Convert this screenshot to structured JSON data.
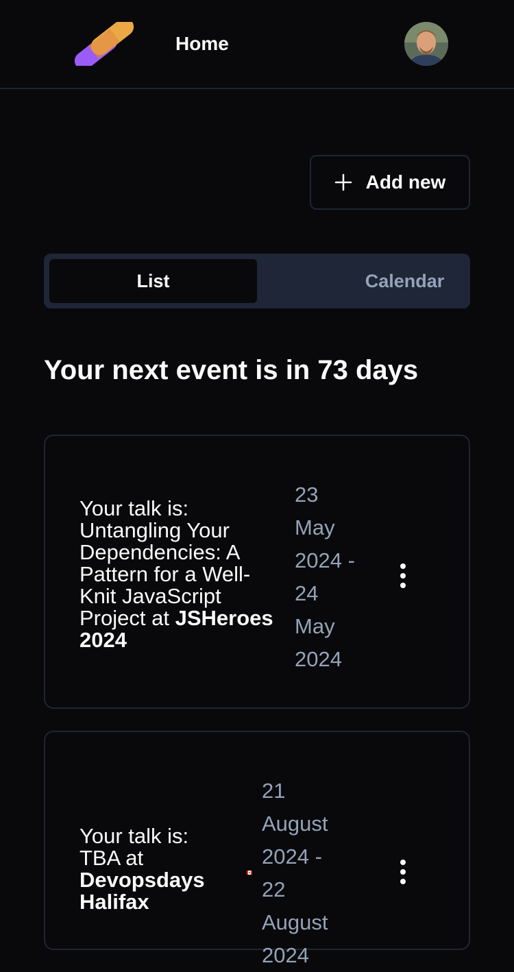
{
  "header": {
    "nav_home": "Home",
    "avatar_alt": "user avatar"
  },
  "toolbar": {
    "add_new_label": "Add new",
    "add_icon": "plus-icon"
  },
  "view_tabs": [
    {
      "label": "List",
      "active": true
    },
    {
      "label": "Calendar",
      "active": false
    }
  ],
  "next_event_text": "Your next event is in 73 days",
  "events": [
    {
      "talk_prefix": "Your talk is:",
      "talk_title": "Untangling Your Dependencies: A Pattern for a Well-Knit JavaScript Project",
      "at_word": "at",
      "event_name": "JSHeroes 2024",
      "date_range": "23 May 2024 - 24 May 2024",
      "menu_icon": "kebab-menu-icon"
    },
    {
      "talk_prefix": "Your talk is:",
      "talk_title": "TBA",
      "at_word": "at",
      "event_name": "Devopsdays Halifax",
      "date_range": "21 August 2024 - 22 August 2024",
      "flag_icon": "canada-flag-icon",
      "menu_icon": "kebab-menu-icon"
    }
  ],
  "colors": {
    "background": "#09090b",
    "border": "#1e2534",
    "tab_track": "#1e2637",
    "muted_text": "#94a3b8",
    "logo_purple": "#8b3cf7",
    "logo_orange": "#f5a623"
  }
}
